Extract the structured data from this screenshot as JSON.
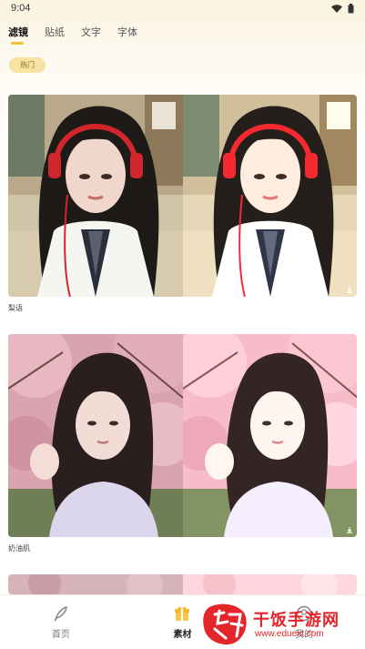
{
  "status_bar": {
    "time": "9:04"
  },
  "tabs": [
    {
      "label": "滤镜",
      "active": true
    },
    {
      "label": "贴纸",
      "active": false
    },
    {
      "label": "文字",
      "active": false
    },
    {
      "label": "字体",
      "active": false
    }
  ],
  "chip": {
    "label": "热门"
  },
  "cards": [
    {
      "label": "梨语",
      "icon": "download-icon"
    },
    {
      "label": "奶油肌",
      "icon": "download-icon"
    },
    {
      "label": ""
    }
  ],
  "bottom_nav": [
    {
      "label": "首页",
      "icon": "feather-icon",
      "active": false
    },
    {
      "label": "素材",
      "icon": "gift-icon",
      "active": true
    },
    {
      "label": "我的",
      "icon": "profile-icon",
      "active": false
    }
  ],
  "watermark": {
    "text": "干饭手游网",
    "url": "www.eduext.com"
  },
  "colors": {
    "accent": "#F2C233",
    "chip_bg": "#F7E3A4",
    "watermark": "#E4252A"
  }
}
